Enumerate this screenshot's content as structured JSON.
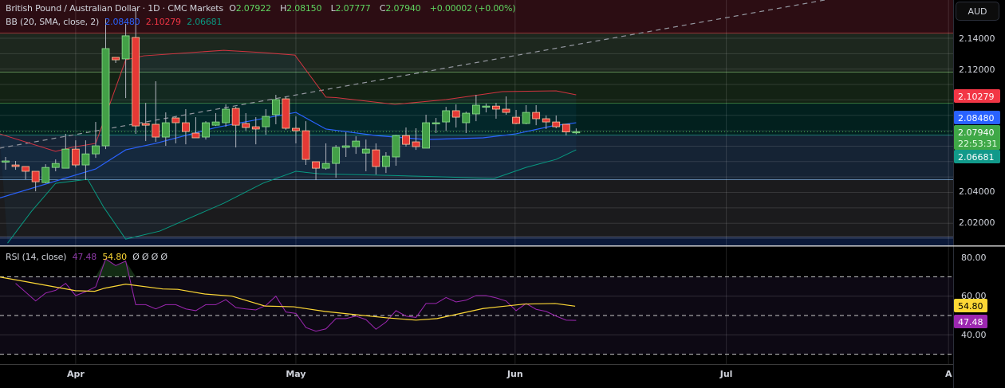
{
  "header": {
    "symbol_title": "British Pound / Australian Dollar · 1D · CMC Markets",
    "open_label": "O",
    "open": "2.07922",
    "high_label": "H",
    "high": "2.08150",
    "low_label": "L",
    "low": "2.07777",
    "close_label": "C",
    "close": "2.07940",
    "change": "+0.00002 (+0.00%)"
  },
  "bb_legend": {
    "label": "BB (20, SMA, close, 2)",
    "basis": "2.08480",
    "upper": "2.10279",
    "lower": "2.06681"
  },
  "rsi_legend": {
    "label": "RSI (14, close)",
    "rsi": "47.48",
    "ma": "54.80",
    "extra": "Ø Ø Ø Ø"
  },
  "currency_button": "AUD",
  "price_axis": {
    "ticks": [
      "2.14000",
      "2.12000",
      "2.04000",
      "2.02000"
    ],
    "badges": {
      "upper": "2.10279",
      "basis": "2.08480",
      "last": "2.07940",
      "countdown": "22:53:31",
      "lower": "2.06681"
    }
  },
  "rsi_axis": {
    "ticks": [
      "80.00",
      "60.00",
      "40.00"
    ],
    "badges": {
      "ma": "54.80",
      "rsi": "47.48"
    }
  },
  "time_axis": {
    "labels": [
      "Apr",
      "May",
      "Jun",
      "Jul",
      "A"
    ]
  },
  "colors": {
    "up": "#43a047",
    "down": "#e53935",
    "wick": "#b2b5be",
    "bb_upper": "#f23645",
    "bb_basis": "#2962ff",
    "bb_lower": "#089981",
    "rsi": "#9c27b0",
    "rsi_ma": "#fdd835"
  },
  "chart_data": [
    {
      "type": "candlestick",
      "title": "British Pound / Australian Dollar · 1D · CMC Markets",
      "x_unit": "trading-day index",
      "y_range": [
        2.0056,
        2.165
      ],
      "y_ticks": [
        2.14,
        2.12,
        2.04,
        2.02
      ],
      "time_labels": [
        {
          "label": "Apr",
          "index": 8
        },
        {
          "label": "May",
          "index": 30
        },
        {
          "label": "Jun",
          "index": 51.9
        },
        {
          "label": "Jul",
          "index": 73
        },
        {
          "label": "A",
          "index": 95.2
        }
      ],
      "ohlc": [
        [
          2.0599,
          2.063,
          2.0547,
          2.0604
        ],
        [
          2.0578,
          2.0604,
          2.0547,
          2.0568
        ],
        [
          2.0568,
          2.0568,
          2.0485,
          2.0537
        ],
        [
          2.0537,
          2.0537,
          2.0407,
          2.0469
        ],
        [
          2.0464,
          2.0583,
          2.0459,
          2.0562
        ],
        [
          2.0562,
          2.0614,
          2.0537,
          2.0588
        ],
        [
          2.0557,
          2.078,
          2.0557,
          2.0681
        ],
        [
          2.0681,
          2.0738,
          2.0562,
          2.0578
        ],
        [
          2.0578,
          2.0738,
          2.048,
          2.065
        ],
        [
          2.065,
          2.0857,
          2.0624,
          2.0702
        ],
        [
          2.0702,
          2.1529,
          2.0681,
          2.1333
        ],
        [
          2.1276,
          2.1276,
          2.124,
          2.126
        ],
        [
          2.1266,
          2.1493,
          2.1012,
          2.1416
        ],
        [
          2.1405,
          2.1596,
          2.078,
          2.0831
        ],
        [
          2.0847,
          2.0981,
          2.0733,
          2.0836
        ],
        [
          2.0842,
          2.1121,
          2.0728,
          2.0759
        ],
        [
          2.0759,
          2.0919,
          2.0702,
          2.0852
        ],
        [
          2.0883,
          2.0888,
          2.0718,
          2.0852
        ],
        [
          2.0852,
          2.094,
          2.0712,
          2.0795
        ],
        [
          2.0785,
          2.0888,
          2.0754,
          2.0754
        ],
        [
          2.0759,
          2.0862,
          2.0743,
          2.0852
        ],
        [
          2.0836,
          2.0914,
          2.0831,
          2.0857
        ],
        [
          2.0852,
          2.0971,
          2.0826,
          2.094
        ],
        [
          2.0945,
          2.0955,
          2.0692,
          2.0836
        ],
        [
          2.0847,
          2.0914,
          2.08,
          2.0821
        ],
        [
          2.0826,
          2.0888,
          2.0712,
          2.0811
        ],
        [
          2.0826,
          2.094,
          2.0774,
          2.0893
        ],
        [
          2.0904,
          2.1033,
          2.0842,
          2.1002
        ],
        [
          2.1007,
          2.1018,
          2.0806,
          2.0816
        ],
        [
          2.0816,
          2.0893,
          2.0718,
          2.08
        ],
        [
          2.08,
          2.0862,
          2.0578,
          2.0614
        ],
        [
          2.0599,
          2.0599,
          2.048,
          2.0557
        ],
        [
          2.0557,
          2.0718,
          2.0547,
          2.0588
        ],
        [
          2.0588,
          2.0707,
          2.0495,
          2.0692
        ],
        [
          2.0692,
          2.079,
          2.063,
          2.0702
        ],
        [
          2.0697,
          2.0764,
          2.065,
          2.0733
        ],
        [
          2.0655,
          2.0743,
          2.0537,
          2.0681
        ],
        [
          2.0676,
          2.0718,
          2.0516,
          2.0568
        ],
        [
          2.0568,
          2.0661,
          2.0526,
          2.0635
        ],
        [
          2.063,
          2.0774,
          2.0573,
          2.0769
        ],
        [
          2.0769,
          2.0821,
          2.0697,
          2.0712
        ],
        [
          2.0728,
          2.0816,
          2.0676,
          2.0697
        ],
        [
          2.0687,
          2.0904,
          2.0687,
          2.0852
        ],
        [
          2.0847,
          2.0883,
          2.0785,
          2.0852
        ],
        [
          2.0857,
          2.0955,
          2.08,
          2.093
        ],
        [
          2.093,
          2.0971,
          2.0821,
          2.0888
        ],
        [
          2.0852,
          2.0924,
          2.0785,
          2.0914
        ],
        [
          2.0909,
          2.1033,
          2.0862,
          2.0966
        ],
        [
          2.096,
          2.0976,
          2.0919,
          2.096
        ],
        [
          2.096,
          2.0981,
          2.0878,
          2.094
        ],
        [
          2.094,
          2.1023,
          2.0904,
          2.0919
        ],
        [
          2.0888,
          2.0935,
          2.0842,
          2.0847
        ],
        [
          2.0847,
          2.0966,
          2.0842,
          2.0919
        ],
        [
          2.0919,
          2.0966,
          2.0836,
          2.0878
        ],
        [
          2.0878,
          2.0899,
          2.0811,
          2.0857
        ],
        [
          2.0857,
          2.0899,
          2.0816,
          2.0826
        ],
        [
          2.0842,
          2.0842,
          2.0769,
          2.0792
        ],
        [
          2.07922,
          2.0815,
          2.07777,
          2.0794
        ]
      ],
      "bollinger": {
        "upper": [
          [
            0.4,
            2.078
          ],
          [
            6,
            2.0666
          ],
          [
            7.6,
            2.0692
          ],
          [
            10,
            2.0718
          ],
          [
            13,
            2.126
          ],
          [
            14.8,
            2.1286
          ],
          [
            22.8,
            2.1322
          ],
          [
            26.7,
            2.1307
          ],
          [
            29.9,
            2.1291
          ],
          [
            33,
            2.1018
          ],
          [
            34,
            2.1015
          ],
          [
            39.9,
            2.0971
          ],
          [
            45,
            2.1002
          ],
          [
            50.6,
            2.1054
          ],
          [
            56,
            2.1059
          ],
          [
            58,
            2.1033
          ]
        ],
        "basis": [
          [
            0,
            2.0356
          ],
          [
            10,
            2.0552
          ],
          [
            13,
            2.0676
          ],
          [
            16,
            2.0718
          ],
          [
            22,
            2.0821
          ],
          [
            27,
            2.0883
          ],
          [
            30,
            2.0919
          ],
          [
            33,
            2.0811
          ],
          [
            38,
            2.0769
          ],
          [
            43,
            2.0743
          ],
          [
            48.7,
            2.0754
          ],
          [
            52,
            2.078
          ],
          [
            55.6,
            2.0831
          ],
          [
            58,
            2.0852
          ]
        ],
        "lower": [
          [
            1.2,
            2.0071
          ],
          [
            3.6,
            2.0278
          ],
          [
            6,
            2.0459
          ],
          [
            9.2,
            2.0485
          ],
          [
            10.8,
            2.0304
          ],
          [
            13,
            2.0097
          ],
          [
            16.4,
            2.0149
          ],
          [
            22.8,
            2.033
          ],
          [
            26.7,
            2.0459
          ],
          [
            30,
            2.0537
          ],
          [
            32.3,
            2.0521
          ],
          [
            38.7,
            2.0511
          ],
          [
            45,
            2.05
          ],
          [
            49.8,
            2.049
          ],
          [
            53,
            2.0562
          ],
          [
            56,
            2.0614
          ],
          [
            58,
            2.0676
          ]
        ]
      },
      "drawings": {
        "zones": [
          {
            "from": 2.1431,
            "to": 2.165,
            "fill": "#2c0d13",
            "line": "#d24a4a"
          },
          {
            "from": 2.1178,
            "to": 2.1431,
            "fill": "#1d271e",
            "line": "#8bd17c"
          },
          {
            "from": 2.0976,
            "to": 2.1178,
            "fill": "#132214",
            "line": "#56b85a"
          },
          {
            "from": 2.077,
            "to": 2.0976,
            "fill": "#02201e",
            "line": "#2aa79b"
          },
          {
            "from": 2.048,
            "to": 2.077,
            "fill": "#152334",
            "line": "#8ab9e6"
          },
          {
            "from": 2.0108,
            "to": 2.048,
            "fill": "#1b1b1d",
            "line": "#8291b8"
          },
          {
            "from": 2.0056,
            "to": 2.0108,
            "fill": "#0a1838",
            "line": "#0a1838"
          }
        ],
        "trend_line": {
          "start": [
            0.4,
            2.0687
          ],
          "end": [
            83,
            2.165
          ]
        },
        "current_price_line": 2.0794
      }
    },
    {
      "type": "line",
      "title": "RSI (14, close)",
      "y_range": [
        24,
        85
      ],
      "y_ticks": [
        80,
        60,
        40
      ],
      "bands": [
        70,
        50,
        30
      ],
      "series": [
        {
          "name": "RSI",
          "values": [
            66.6,
            62.1,
            57.5,
            61.6,
            63.0,
            66.6,
            60.3,
            62.3,
            64.8,
            79.2,
            75.8,
            78.1,
            55.6,
            55.6,
            53.4,
            55.6,
            55.6,
            53.4,
            52.5,
            55.6,
            55.6,
            58.2,
            54.1,
            53.4,
            52.9,
            55.2,
            60.0,
            51.8,
            51.1,
            43.8,
            41.9,
            43.1,
            48.4,
            48.4,
            49.7,
            47.9,
            42.9,
            46.6,
            52.5,
            49.7,
            49.0,
            56.2,
            56.2,
            59.3,
            57.0,
            57.9,
            60.3,
            60.3,
            59.1,
            57.5,
            52.5,
            56.2,
            53.2,
            52.1,
            49.7,
            47.6,
            47.48
          ]
        },
        {
          "name": "RSI-based MA",
          "points": [
            [
              0.4,
              69.9
            ],
            [
              2.9,
              67.6
            ],
            [
              8,
              62.8
            ],
            [
              9.9,
              62.5
            ],
            [
              10.9,
              64.1
            ],
            [
              13,
              66.2
            ],
            [
              16.7,
              63.7
            ],
            [
              18.2,
              63.5
            ],
            [
              20.9,
              61.1
            ],
            [
              23.6,
              60.0
            ],
            [
              26.9,
              54.9
            ],
            [
              29.8,
              54.5
            ],
            [
              32.9,
              52.1
            ],
            [
              36,
              50.4
            ],
            [
              39.1,
              48.8
            ],
            [
              42,
              47.6
            ],
            [
              44.1,
              48.4
            ],
            [
              48.7,
              53.6
            ],
            [
              52.8,
              55.9
            ],
            [
              55.9,
              56.2
            ],
            [
              57.9,
              54.8
            ]
          ]
        }
      ]
    }
  ]
}
